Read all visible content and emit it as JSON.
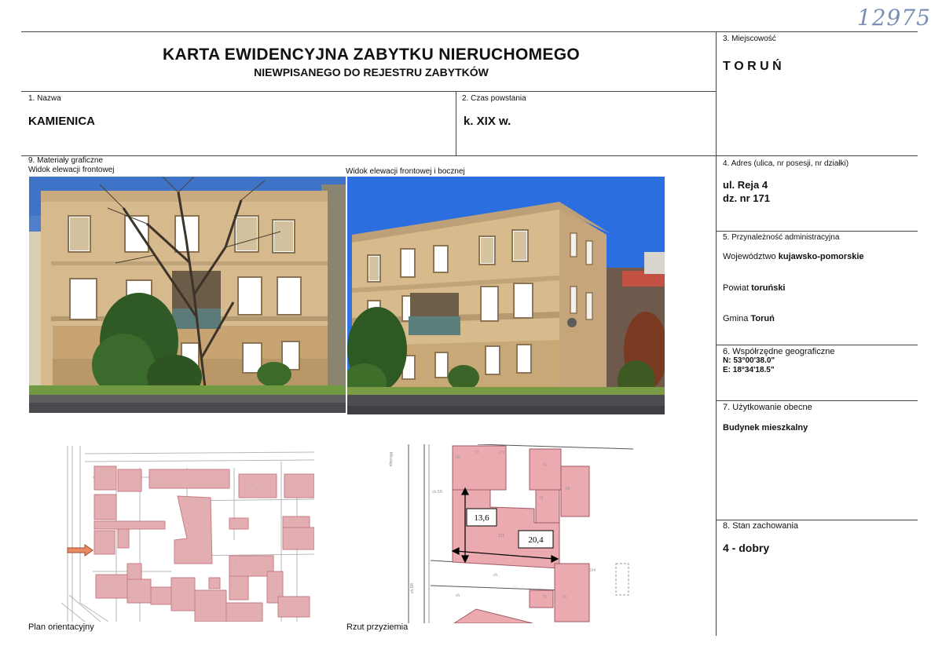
{
  "header": {
    "registry_number": "12975",
    "title_line1": "KARTA EWIDENCYJNA ZABYTKU NIERUCHOMEGO",
    "title_line2": "NIEWPISANEGO DO REJESTRU ZABYTKÓW"
  },
  "fields": {
    "name_label": "1. Nazwa",
    "name_value": "KAMIENICA",
    "period_label": "2. Czas powstania",
    "period_value": "k. XIX w.",
    "locality_label": "3. Miejscowość",
    "locality_value": "T O R U Ń",
    "address_label": "4. Adres (ulica, nr posesji, nr działki)",
    "address_line1": "ul. Reja 4",
    "address_line2": "dz. nr 171",
    "admin_label": "5. Przynależność administracyjna",
    "voivodeship_prefix": "Województwo",
    "voivodeship_value": "kujawsko-pomorskie",
    "county_prefix": "Powiat",
    "county_value": "toruński",
    "commune_prefix": "Gmina",
    "commune_value": "Toruń",
    "coords_label": "6. Współrzędne geograficzne",
    "coords_n": "N: 53°00'38.0\"",
    "coords_e": "E: 18°34'18.5\"",
    "usage_label": "7. Użytkowanie obecne",
    "usage_value": "Budynek mieszkalny",
    "condition_label": "8. Stan zachowania",
    "condition_value": "4 - dobry"
  },
  "graphics": {
    "section_label": "9. Materiały graficzne",
    "photo1_caption": "Widok elewacji frontowej",
    "photo2_caption": "Widok elewacji frontowej i bocznej",
    "plan_caption": "Plan orientacyjny",
    "floor_caption": "Rzut przyziemia",
    "dim_length": "13,6",
    "dim_width": "20,4",
    "parcel_number": "171"
  }
}
